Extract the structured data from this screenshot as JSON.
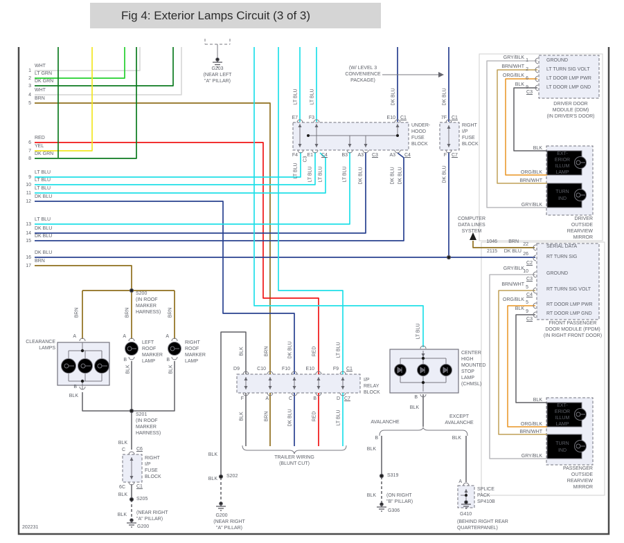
{
  "title": "Fig 4: Exterior Lamps Circuit (3 of 3)",
  "diagram_id": "202231",
  "colors": {
    "wht": "#d9d9d9",
    "lt_grn": "#22cf2c",
    "dk_grn": "#0b7a1e",
    "brn": "#8f6f1d",
    "red": "#f01414",
    "yel": "#f2e722",
    "lt_blu": "#1edfe8",
    "dk_blu": "#27408f",
    "blk": "#5f5f64",
    "gry_blk": "#bababd",
    "brn_wht": "#bf9f56",
    "org_blk": "#e89320",
    "block_fill": "#eceef7",
    "text": "#5d6068",
    "title_bg": "#d5d5d5",
    "title_text": "#2b2b2b"
  },
  "wire_names": {
    "wht": "WHT",
    "lt_grn": "LT GRN",
    "dk_grn": "DK GRN",
    "brn": "BRN",
    "red": "RED",
    "yel": "YEL",
    "lt_blu": "LT BLU",
    "dk_blu": "DK BLU",
    "blk": "BLK",
    "gry_blk": "GRY/BLK",
    "brn_wht": "BRN/WHT",
    "org_blk": "ORG/BLK"
  },
  "left_rows": [
    {
      "num": "1",
      "color": "wht"
    },
    {
      "num": "2",
      "color": "lt_grn"
    },
    {
      "num": "3",
      "color": "dk_grn"
    },
    {
      "num": "4",
      "color": "wht"
    },
    {
      "num": "5",
      "color": "brn"
    },
    {
      "num": "6",
      "color": "red"
    },
    {
      "num": "7",
      "color": "yel"
    },
    {
      "num": "8",
      "color": "dk_grn"
    },
    {
      "num": "9",
      "color": "lt_blu"
    },
    {
      "num": "10",
      "color": "lt_blu"
    },
    {
      "num": "11",
      "color": "lt_blu"
    },
    {
      "num": "12",
      "color": "dk_blu"
    },
    {
      "num": "13",
      "color": "lt_blu"
    },
    {
      "num": "14",
      "color": "dk_blu"
    },
    {
      "num": "15",
      "color": "dk_blu"
    },
    {
      "num": "16",
      "color": "dk_blu"
    },
    {
      "num": "17",
      "color": "brn"
    }
  ],
  "terms": {
    "a": "A",
    "b": "B"
  },
  "notes": {
    "level3": [
      "(W/ LEVEL 3",
      "CONVENIENCE",
      "PACKAGE)"
    ],
    "computer": [
      "COMPUTER",
      "DATA LINES",
      "SYSTEM"
    ],
    "trailer": [
      "TRAILER WIRING",
      "(BLUNT CUT)"
    ],
    "avalanche": "AVALANCHE",
    "except": [
      "EXCEPT",
      "AVALANCHE"
    ]
  },
  "grounds": {
    "g203": [
      "G203",
      "(NEAR LEFT",
      "\"A\" PILLAR)"
    ],
    "g200a": [
      "G200",
      "(NEAR RIGHT",
      "\"A\" PILLAR)"
    ],
    "g200b": [
      "G200",
      "(NEAR RIGHT",
      "\"A\" PILLAR)"
    ],
    "g306": [
      "G306",
      "(ON RIGHT",
      "\"B\" PILLAR)"
    ],
    "g410": [
      "G410",
      "(BEHIND RIGHT REAR",
      "QUARTERPANEL)"
    ]
  },
  "splices": {
    "s200": [
      "S200",
      "(IN ROOF",
      "MARKER",
      "HARNESS)"
    ],
    "s201": [
      "S201",
      "(IN ROOF",
      "MARKER",
      "HARNESS)"
    ],
    "s202": "S202",
    "s205": "S205",
    "s319": "S319",
    "pack": [
      "SPLICE",
      "PACK",
      "SP410B"
    ]
  },
  "fuse_underhood": {
    "name": [
      "UNDER-",
      "HOOD",
      "FUSE",
      "BLOCK"
    ],
    "top": {
      "e7": "E7",
      "f3": "F3",
      "e10": "E10",
      "c1": "C1"
    },
    "bottom": {
      "f4": "F4",
      "c3": "C3",
      "e1": "E1",
      "c4": "C4",
      "b3": "B3",
      "a3": "A3",
      "c3b": "C3",
      "a3b": "A3",
      "c4b": "C4"
    }
  },
  "fuse_right_ip_top": {
    "name": [
      "RIGHT",
      "I/P",
      "FUSE",
      "BLOCK"
    ],
    "pin_7f": "7F",
    "c1": "C1",
    "pin_f": "F",
    "c7": "C7"
  },
  "fuse_right_ip_left": {
    "name": [
      "RIGHT",
      "I/P",
      "FUSE",
      "BLOCK"
    ],
    "pin_c": "C",
    "c6": "C6",
    "pin_6c": "6C",
    "c1": "C1"
  },
  "relay": {
    "name": [
      "I/P",
      "RELAY",
      "BLOCK"
    ],
    "top": [
      "D9",
      "C10",
      "F10",
      "E10",
      "F9"
    ],
    "c1": "C1",
    "bottom": [
      "F",
      "A",
      "C",
      "B",
      "D"
    ],
    "c7": "C7"
  },
  "lamps": {
    "clearance": [
      "CLEARANCE",
      "LAMPS"
    ],
    "left_marker": [
      "LEFT",
      "ROOF",
      "MARKER",
      "LAMP"
    ],
    "right_marker": [
      "RIGHT",
      "ROOF",
      "MARKER",
      "LAMP"
    ],
    "chmsl": [
      "CENTER",
      "HIGH",
      "MOUNTED",
      "STOP",
      "LAMP",
      "(CHMSL)"
    ]
  },
  "ddm": {
    "name": [
      "DRIVER DOOR",
      "MODULE (DDM)",
      "(IN DRIVER'S DOOR)"
    ],
    "conn": "C3",
    "pins": [
      {
        "wire": "gry_blk",
        "num": "1",
        "fn": "GROUND"
      },
      {
        "wire": "brn_wht",
        "num": "2",
        "fn": "LT TURN SIG VOLT"
      },
      {
        "wire": "org_blk",
        "num": "6",
        "fn": "LT DOOR LMP PWR"
      },
      {
        "wire": "blk",
        "num": "9",
        "fn": "LT DOOR LMP GND"
      }
    ]
  },
  "fpdm": {
    "name": [
      "FRONT PASSENGER",
      "DOOR MODULE (FPDM)",
      "(IN RIGHT FRONT DOOR)"
    ],
    "serial": {
      "circuit": "1046",
      "num": "22",
      "fn": "SERIAL DATA"
    },
    "turnsig": {
      "circuit": "2115",
      "num": "26",
      "fn": "RT TURN SIG",
      "conn": "C2"
    },
    "pins": [
      {
        "wire": "gry_blk",
        "num": "10",
        "fn": "GROUND",
        "conn": "C3"
      },
      {
        "wire": "brn_wht",
        "num": "5",
        "fn": "RT TURN SIG VOLT",
        "conn": "C4"
      },
      {
        "wire": "org_blk",
        "num": "5",
        "fn": "RT DOOR LMP PWR"
      },
      {
        "wire": "blk",
        "num": "9",
        "fn": "RT DOOR LMP GND",
        "conn": "C3"
      }
    ]
  },
  "mirrors": {
    "illum": [
      "EXT-",
      "ERIOR",
      "ILLUM",
      "LAMP"
    ],
    "turn": [
      "TURN",
      "IND"
    ],
    "driver": [
      "DRIVER",
      "OUTSIDE",
      "REARVIEW",
      "MIRROR"
    ],
    "passenger": [
      "PASSENGER",
      "OUTSIDE",
      "REARVIEW",
      "MIRROR"
    ]
  }
}
